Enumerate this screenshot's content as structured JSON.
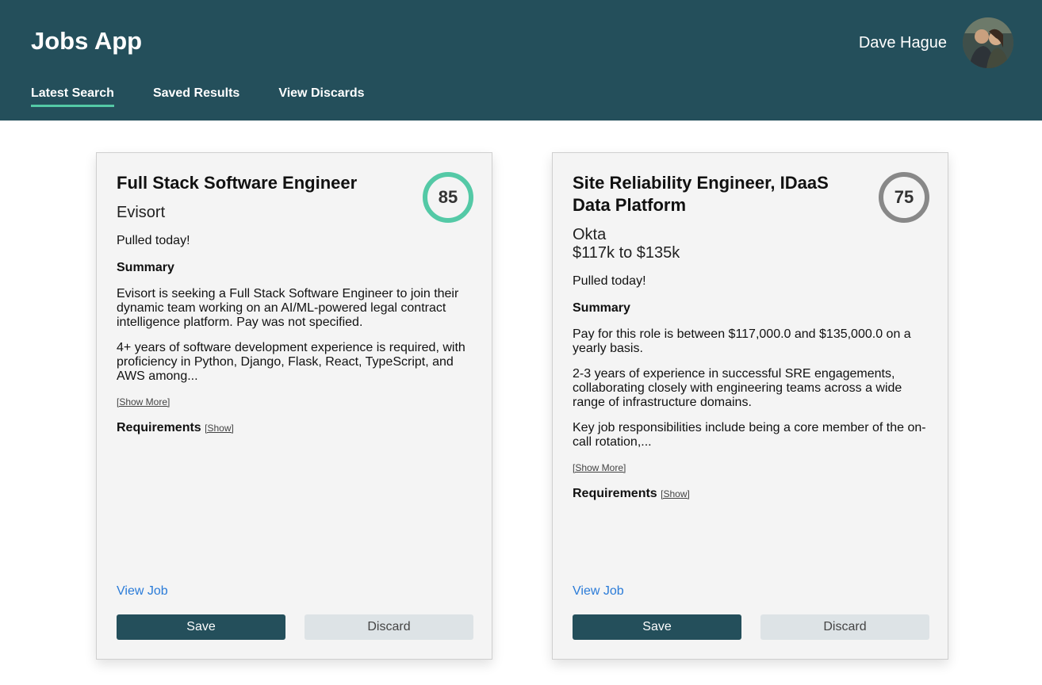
{
  "app": {
    "title": "Jobs App"
  },
  "user": {
    "name": "Dave Hague"
  },
  "nav": {
    "tabs": [
      {
        "label": "Latest Search",
        "active": true
      },
      {
        "label": "Saved Results",
        "active": false
      },
      {
        "label": "View Discards",
        "active": false
      }
    ]
  },
  "colors": {
    "header": "#244f5b",
    "accent": "#54c9a6",
    "link": "#2a7bd8"
  },
  "jobs": [
    {
      "title": "Full Stack Software Engineer",
      "score": "85",
      "company": "Evisort",
      "salary": "",
      "pulled": "Pulled today!",
      "summary_label": "Summary",
      "paragraphs": [
        "Evisort is seeking a Full Stack Software Engineer to join their dynamic team working on an AI/ML-powered legal contract intelligence platform. Pay was not specified.",
        "4+ years of software development experience is required, with proficiency in Python, Django, Flask, React, TypeScript, and AWS among..."
      ],
      "show_more": "[Show More]",
      "requirements_label": "Requirements",
      "requirements_show": "[Show]",
      "view_job": "View Job",
      "save": "Save",
      "discard": "Discard"
    },
    {
      "title": "Site Reliability Engineer, IDaaS Data Platform",
      "score": "75",
      "company": "Okta",
      "salary": "$117k to $135k",
      "pulled": "Pulled today!",
      "summary_label": "Summary",
      "paragraphs": [
        "Pay for this role is between $117,000.0 and $135,000.0 on a yearly basis.",
        "2-3 years of experience in successful SRE engagements, collaborating closely with engineering teams across a wide range of infrastructure domains.",
        "Key job responsibilities include being a core member of the on-call rotation,..."
      ],
      "show_more": "[Show More]",
      "requirements_label": "Requirements",
      "requirements_show": "[Show]",
      "view_job": "View Job",
      "save": "Save",
      "discard": "Discard"
    }
  ]
}
